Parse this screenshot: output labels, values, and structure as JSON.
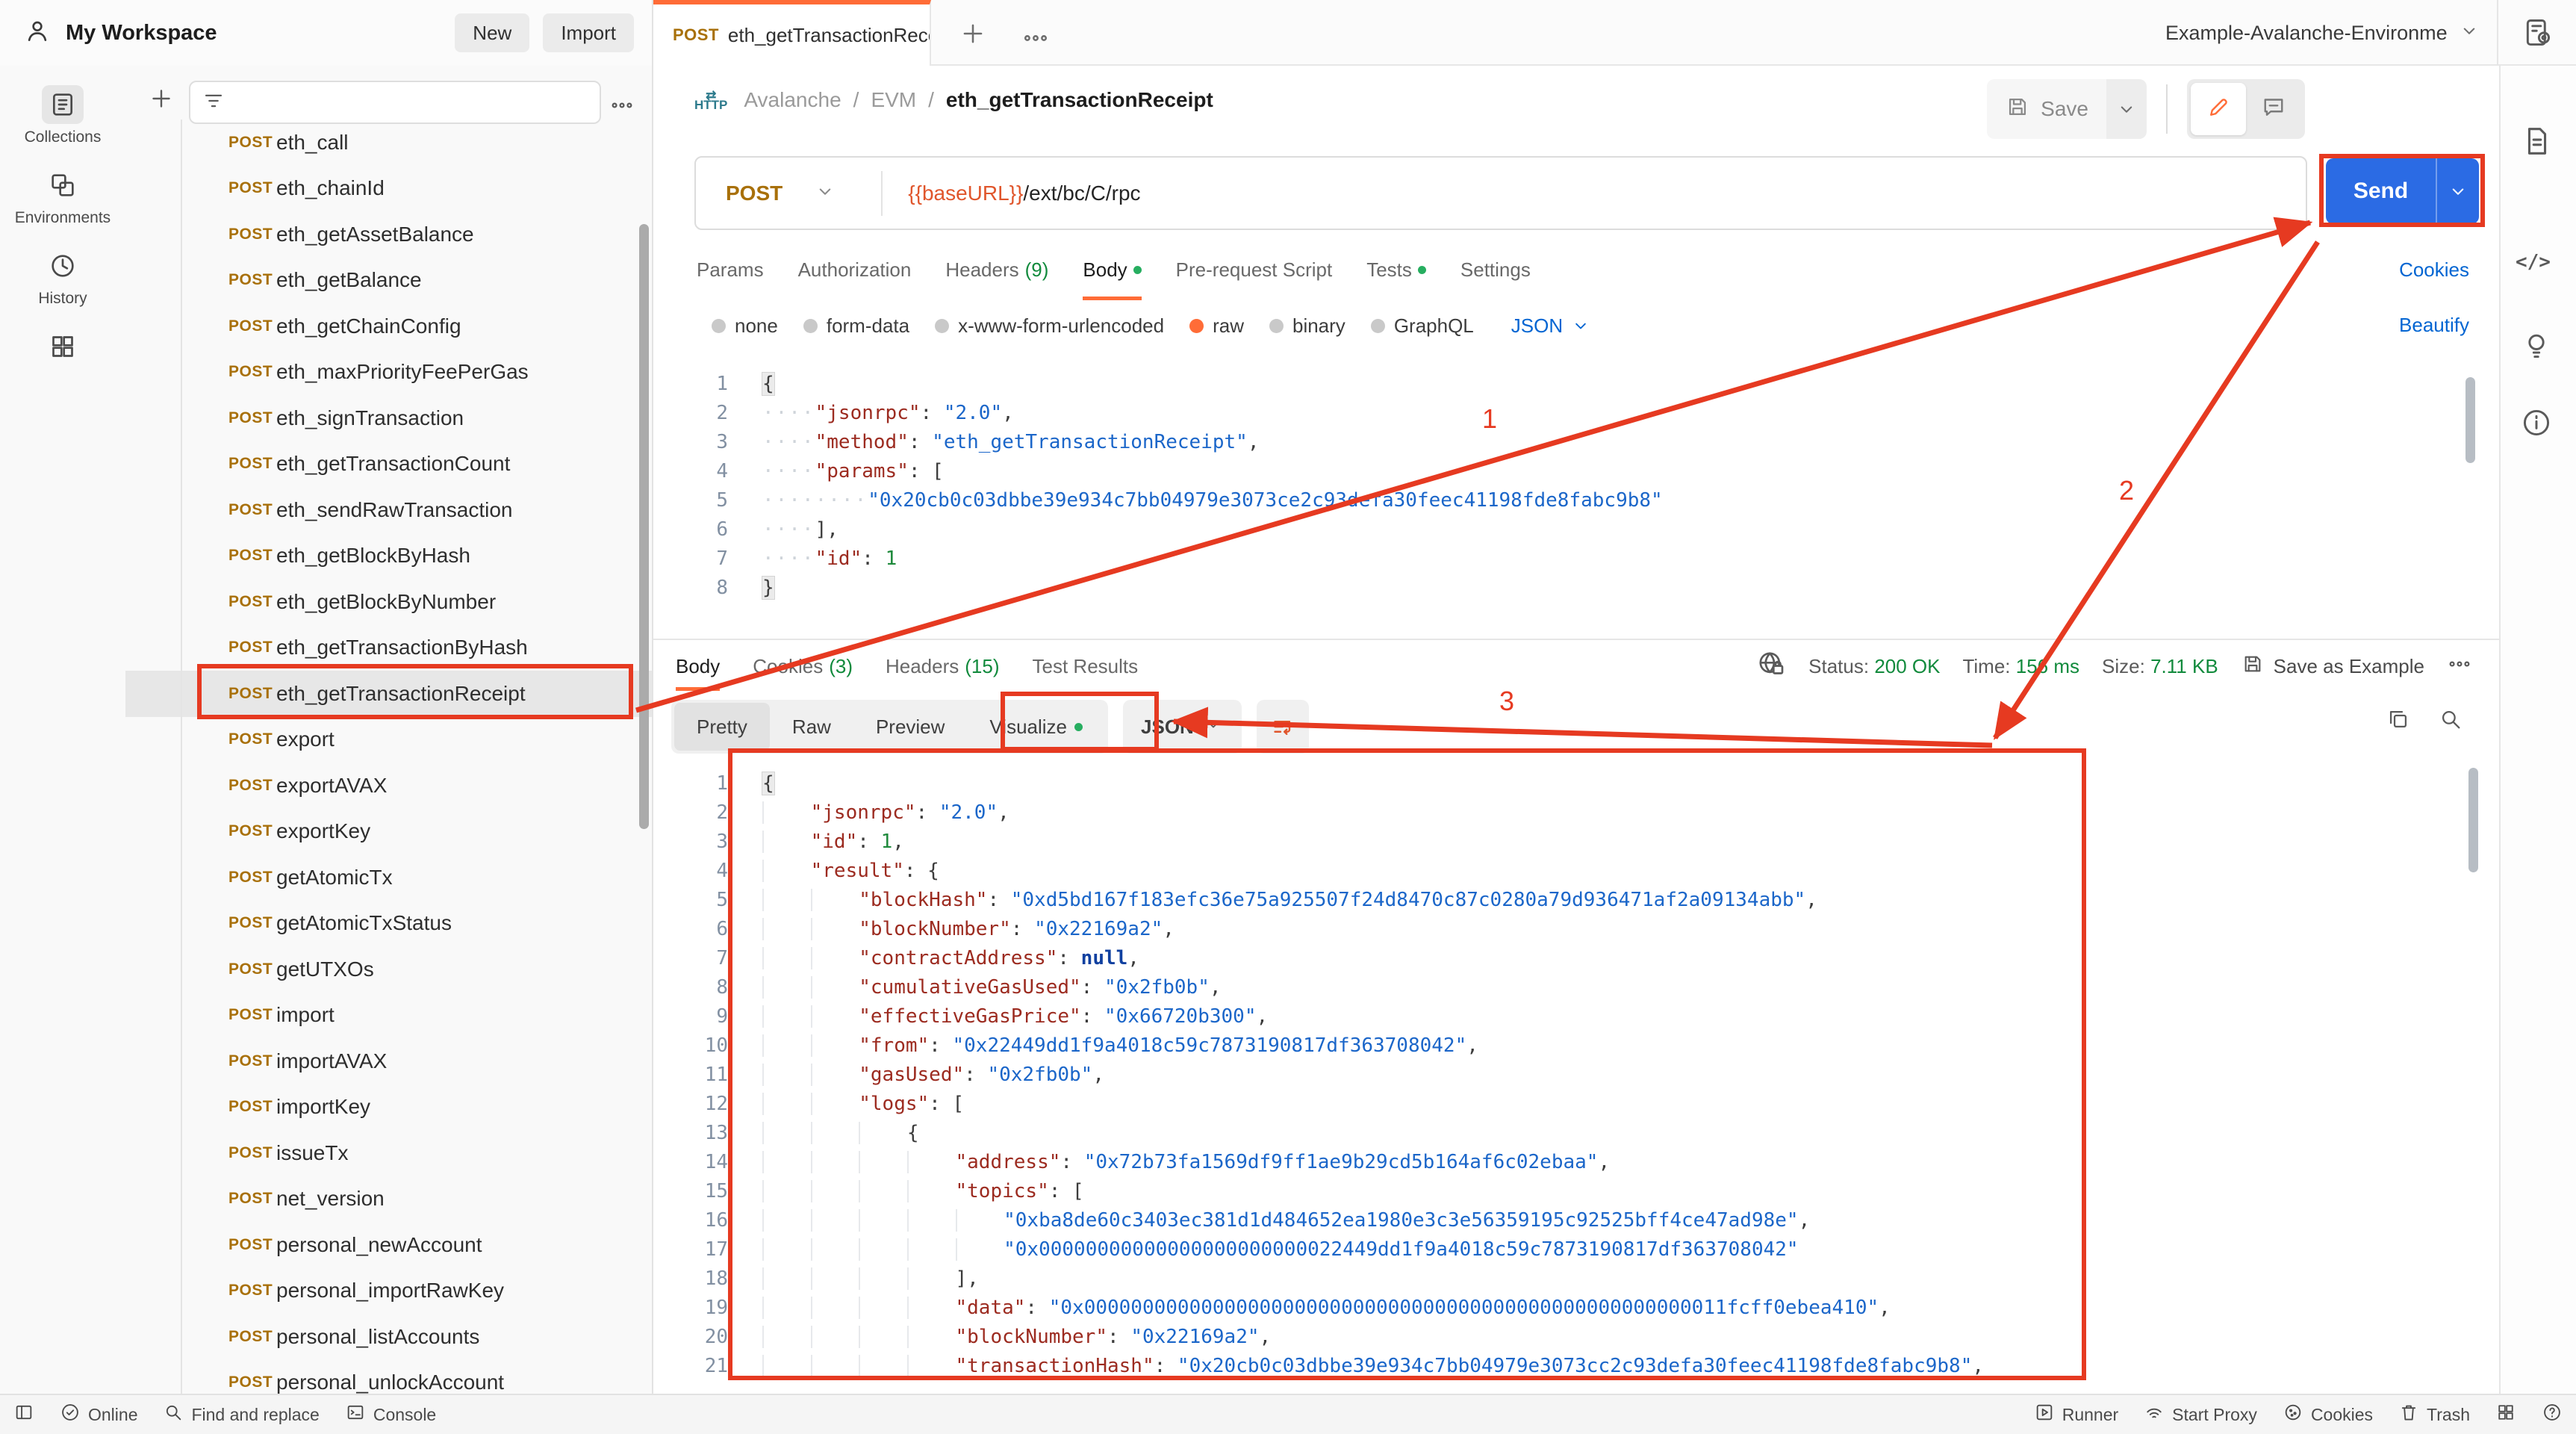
{
  "header": {
    "workspace": "My Workspace",
    "new_label": "New",
    "import_label": "Import",
    "tab": {
      "method": "POST",
      "title": "eth_getTransactionRece"
    },
    "environment": "Example-Avalanche-Environme"
  },
  "activity_bar": {
    "items": [
      {
        "icon": "collections-icon",
        "label": "Collections",
        "active": true
      },
      {
        "icon": "environments-icon",
        "label": "Environments",
        "active": false
      },
      {
        "icon": "history-icon",
        "label": "History",
        "active": false
      },
      {
        "icon": "grid-icon",
        "label": "",
        "active": false
      }
    ]
  },
  "sidebar": {
    "items": [
      "eth_call",
      "eth_chainId",
      "eth_getAssetBalance",
      "eth_getBalance",
      "eth_getChainConfig",
      "eth_maxPriorityFeePerGas",
      "eth_signTransaction",
      "eth_getTransactionCount",
      "eth_sendRawTransaction",
      "eth_getBlockByHash",
      "eth_getBlockByNumber",
      "eth_getTransactionByHash",
      "eth_getTransactionReceipt",
      "export",
      "exportAVAX",
      "exportKey",
      "getAtomicTx",
      "getAtomicTxStatus",
      "getUTXOs",
      "import",
      "importAVAX",
      "importKey",
      "issueTx",
      "net_version",
      "personal_newAccount",
      "personal_importRawKey",
      "personal_listAccounts",
      "personal_unlockAccount"
    ],
    "method_badge": "POST",
    "selected_index": 12
  },
  "request": {
    "breadcrumb": [
      "Avalanche",
      "EVM",
      "eth_getTransactionReceipt"
    ],
    "http_badge": "HTTP",
    "save_label": "Save",
    "method": "POST",
    "url_var": "{{baseURL}}",
    "url_path": "/ext/bc/C/rpc",
    "send_label": "Send",
    "tabs": [
      {
        "label": "Params"
      },
      {
        "label": "Authorization"
      },
      {
        "label": "Headers",
        "count": "(9)"
      },
      {
        "label": "Body",
        "dot": true,
        "active": true
      },
      {
        "label": "Pre-request Script"
      },
      {
        "label": "Tests",
        "dot": true
      },
      {
        "label": "Settings"
      }
    ],
    "cookies_link": "Cookies",
    "body_modes": [
      {
        "label": "none"
      },
      {
        "label": "form-data"
      },
      {
        "label": "x-www-form-urlencoded"
      },
      {
        "label": "raw",
        "selected": true
      },
      {
        "label": "binary"
      },
      {
        "label": "GraphQL"
      }
    ],
    "language": "JSON",
    "beautify_link": "Beautify",
    "code_lines": [
      [
        [
          "f",
          "{"
        ]
      ],
      [
        [
          "d",
          "····"
        ],
        [
          "k",
          "\"jsonrpc\""
        ],
        [
          "p",
          ": "
        ],
        [
          "s",
          "\"2.0\""
        ],
        [
          "p",
          ","
        ]
      ],
      [
        [
          "d",
          "····"
        ],
        [
          "k",
          "\"method\""
        ],
        [
          "p",
          ": "
        ],
        [
          "s",
          "\"eth_getTransactionReceipt\""
        ],
        [
          "p",
          ","
        ]
      ],
      [
        [
          "d",
          "····"
        ],
        [
          "k",
          "\"params\""
        ],
        [
          "p",
          ": ["
        ]
      ],
      [
        [
          "d",
          "····"
        ],
        [
          "d",
          "····"
        ],
        [
          "s",
          "\"0x20cb0c03dbbe39e934c7bb04979e3073ce2c93defa30feec41198fde8fabc9b8\""
        ]
      ],
      [
        [
          "d",
          "····"
        ],
        [
          "p",
          "],"
        ]
      ],
      [
        [
          "d",
          "····"
        ],
        [
          "k",
          "\"id\""
        ],
        [
          "p",
          ": "
        ],
        [
          "n",
          "1"
        ]
      ],
      [
        [
          "f",
          "}"
        ]
      ]
    ]
  },
  "response": {
    "tabs": [
      {
        "label": "Body",
        "active": true
      },
      {
        "label": "Cookies",
        "count": "(3)"
      },
      {
        "label": "Headers",
        "count": "(15)"
      },
      {
        "label": "Test Results"
      }
    ],
    "status_label": "Status:",
    "status_value": "200 OK",
    "time_label": "Time:",
    "time_value": "156 ms",
    "size_label": "Size:",
    "size_value": "7.11 KB",
    "save_as_example": "Save as Example",
    "view_tabs": [
      {
        "label": "Pretty",
        "active": true
      },
      {
        "label": "Raw"
      },
      {
        "label": "Preview"
      },
      {
        "label": "Visualize",
        "dot": true
      }
    ],
    "language": "JSON",
    "code_lines": [
      [
        [
          "f",
          "{"
        ]
      ],
      [
        [
          "g",
          "    "
        ],
        [
          "k",
          "\"jsonrpc\""
        ],
        [
          "p",
          ": "
        ],
        [
          "s",
          "\"2.0\""
        ],
        [
          "p",
          ","
        ]
      ],
      [
        [
          "g",
          "    "
        ],
        [
          "k",
          "\"id\""
        ],
        [
          "p",
          ": "
        ],
        [
          "n",
          "1"
        ],
        [
          "p",
          ","
        ]
      ],
      [
        [
          "g",
          "    "
        ],
        [
          "k",
          "\"result\""
        ],
        [
          "p",
          ": {"
        ]
      ],
      [
        [
          "g",
          "    "
        ],
        [
          "g",
          "    "
        ],
        [
          "k",
          "\"blockHash\""
        ],
        [
          "p",
          ": "
        ],
        [
          "s",
          "\"0xd5bd167f183efc36e75a925507f24d8470c87c0280a79d936471af2a09134abb\""
        ],
        [
          "p",
          ","
        ]
      ],
      [
        [
          "g",
          "    "
        ],
        [
          "g",
          "    "
        ],
        [
          "k",
          "\"blockNumber\""
        ],
        [
          "p",
          ": "
        ],
        [
          "s",
          "\"0x22169a2\""
        ],
        [
          "p",
          ","
        ]
      ],
      [
        [
          "g",
          "    "
        ],
        [
          "g",
          "    "
        ],
        [
          "k",
          "\"contractAddress\""
        ],
        [
          "p",
          ": "
        ],
        [
          "u",
          "null"
        ],
        [
          "p",
          ","
        ]
      ],
      [
        [
          "g",
          "    "
        ],
        [
          "g",
          "    "
        ],
        [
          "k",
          "\"cumulativeGasUsed\""
        ],
        [
          "p",
          ": "
        ],
        [
          "s",
          "\"0x2fb0b\""
        ],
        [
          "p",
          ","
        ]
      ],
      [
        [
          "g",
          "    "
        ],
        [
          "g",
          "    "
        ],
        [
          "k",
          "\"effectiveGasPrice\""
        ],
        [
          "p",
          ": "
        ],
        [
          "s",
          "\"0x66720b300\""
        ],
        [
          "p",
          ","
        ]
      ],
      [
        [
          "g",
          "    "
        ],
        [
          "g",
          "    "
        ],
        [
          "k",
          "\"from\""
        ],
        [
          "p",
          ": "
        ],
        [
          "s",
          "\"0x22449dd1f9a4018c59c7873190817df363708042\""
        ],
        [
          "p",
          ","
        ]
      ],
      [
        [
          "g",
          "    "
        ],
        [
          "g",
          "    "
        ],
        [
          "k",
          "\"gasUsed\""
        ],
        [
          "p",
          ": "
        ],
        [
          "s",
          "\"0x2fb0b\""
        ],
        [
          "p",
          ","
        ]
      ],
      [
        [
          "g",
          "    "
        ],
        [
          "g",
          "    "
        ],
        [
          "k",
          "\"logs\""
        ],
        [
          "p",
          ": ["
        ]
      ],
      [
        [
          "g",
          "    "
        ],
        [
          "g",
          "    "
        ],
        [
          "g",
          "    "
        ],
        [
          "p",
          "{"
        ]
      ],
      [
        [
          "g",
          "    "
        ],
        [
          "g",
          "    "
        ],
        [
          "g",
          "    "
        ],
        [
          "g",
          "    "
        ],
        [
          "k",
          "\"address\""
        ],
        [
          "p",
          ": "
        ],
        [
          "s",
          "\"0x72b73fa1569df9ff1ae9b29cd5b164af6c02ebaa\""
        ],
        [
          "p",
          ","
        ]
      ],
      [
        [
          "g",
          "    "
        ],
        [
          "g",
          "    "
        ],
        [
          "g",
          "    "
        ],
        [
          "g",
          "    "
        ],
        [
          "k",
          "\"topics\""
        ],
        [
          "p",
          ": ["
        ]
      ],
      [
        [
          "g",
          "    "
        ],
        [
          "g",
          "    "
        ],
        [
          "g",
          "    "
        ],
        [
          "g",
          "    "
        ],
        [
          "g",
          "    "
        ],
        [
          "s",
          "\"0xba8de60c3403ec381d1d484652ea1980e3c3e56359195c92525bff4ce47ad98e\""
        ],
        [
          "p",
          ","
        ]
      ],
      [
        [
          "g",
          "    "
        ],
        [
          "g",
          "    "
        ],
        [
          "g",
          "    "
        ],
        [
          "g",
          "    "
        ],
        [
          "g",
          "    "
        ],
        [
          "s",
          "\"0x00000000000000000000000022449dd1f9a4018c59c7873190817df363708042\""
        ]
      ],
      [
        [
          "g",
          "    "
        ],
        [
          "g",
          "    "
        ],
        [
          "g",
          "    "
        ],
        [
          "g",
          "    "
        ],
        [
          "p",
          "],"
        ]
      ],
      [
        [
          "g",
          "    "
        ],
        [
          "g",
          "    "
        ],
        [
          "g",
          "    "
        ],
        [
          "g",
          "    "
        ],
        [
          "k",
          "\"data\""
        ],
        [
          "p",
          ": "
        ],
        [
          "s",
          "\"0x0000000000000000000000000000000000000000000000000000011fcff0ebea410\""
        ],
        [
          "p",
          ","
        ]
      ],
      [
        [
          "g",
          "    "
        ],
        [
          "g",
          "    "
        ],
        [
          "g",
          "    "
        ],
        [
          "g",
          "    "
        ],
        [
          "k",
          "\"blockNumber\""
        ],
        [
          "p",
          ": "
        ],
        [
          "s",
          "\"0x22169a2\""
        ],
        [
          "p",
          ","
        ]
      ],
      [
        [
          "g",
          "    "
        ],
        [
          "g",
          "    "
        ],
        [
          "g",
          "    "
        ],
        [
          "g",
          "    "
        ],
        [
          "k",
          "\"transactionHash\""
        ],
        [
          "p",
          ": "
        ],
        [
          "s",
          "\"0x20cb0c03dbbe39e934c7bb04979e3073cc2c93defa30feec41198fde8fabc9b8\""
        ],
        [
          "p",
          ","
        ]
      ]
    ]
  },
  "annotations": {
    "labels": [
      "1",
      "2",
      "3"
    ],
    "color": "#e63a21"
  },
  "footer": {
    "left": [
      {
        "icon": "panel-toggle-icon",
        "label": ""
      },
      {
        "icon": "online-check-icon",
        "label": "Online"
      },
      {
        "icon": "find-icon",
        "label": "Find and replace"
      },
      {
        "icon": "console-icon",
        "label": "Console"
      }
    ],
    "right": [
      {
        "icon": "runner-icon",
        "label": "Runner"
      },
      {
        "icon": "proxy-icon",
        "label": "Start Proxy"
      },
      {
        "icon": "cookie-icon",
        "label": "Cookies"
      },
      {
        "icon": "trash-icon",
        "label": "Trash"
      },
      {
        "icon": "panel-grid-icon",
        "label": ""
      },
      {
        "icon": "help-icon",
        "label": ""
      }
    ]
  }
}
